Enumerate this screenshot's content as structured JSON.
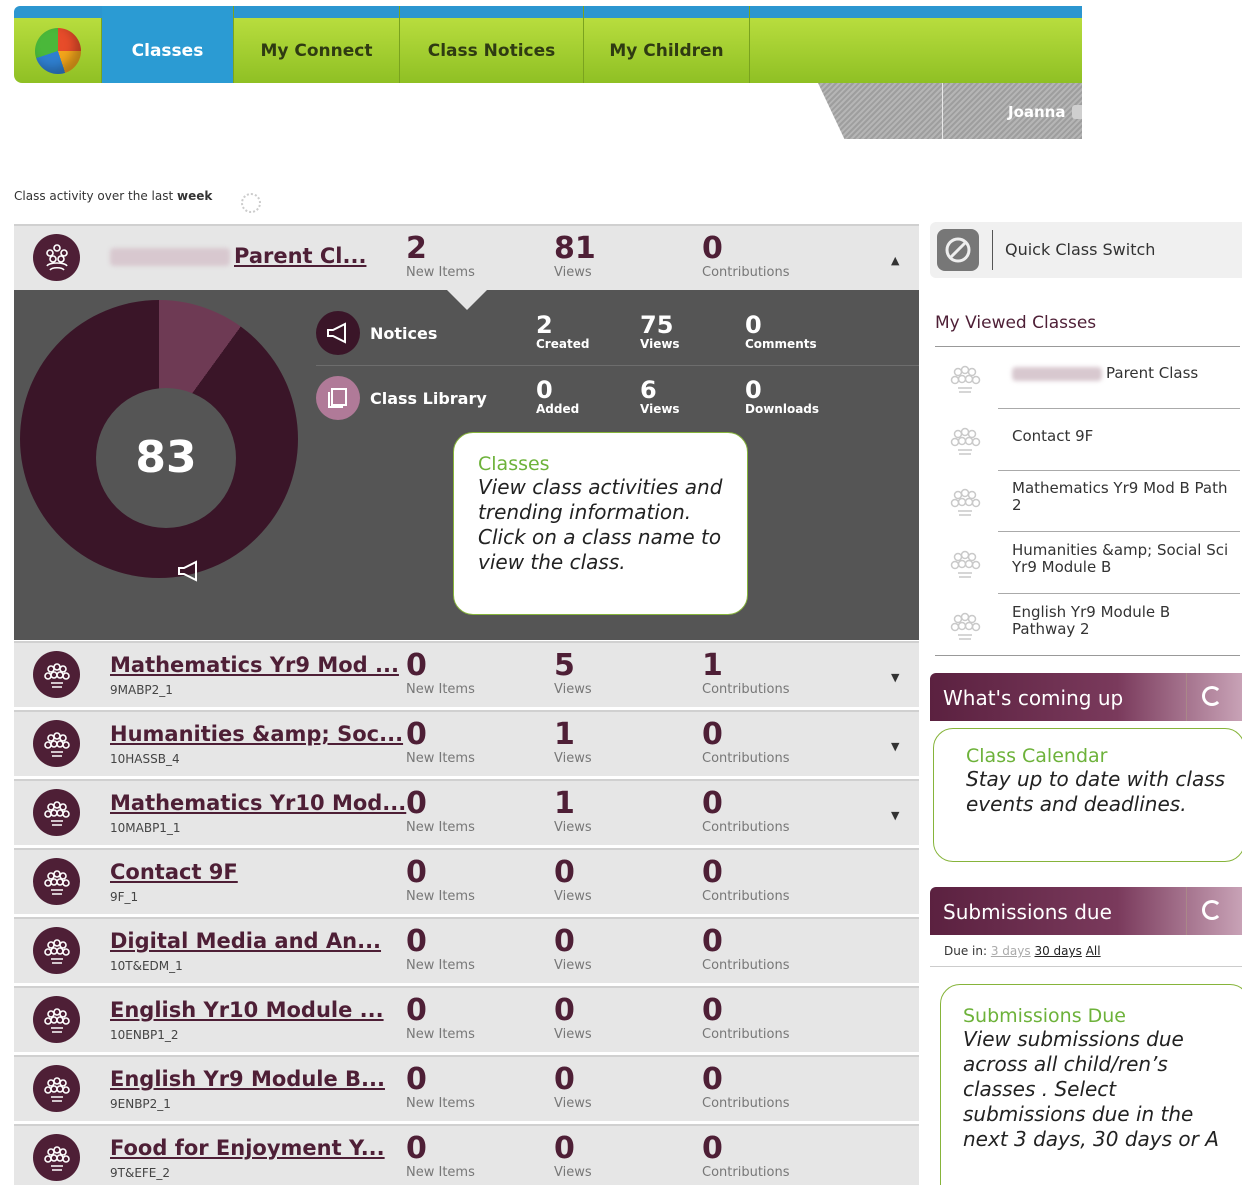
{
  "nav": {
    "tabs": [
      "Classes",
      "My Connect",
      "Class Notices",
      "My Children"
    ],
    "active_tab": "Classes",
    "user_name": "Joanna"
  },
  "activity": {
    "prefix": "Class activity over the last ",
    "period": "week"
  },
  "stat_labels": {
    "new_items": "New Items",
    "views": "Views",
    "contributions": "Contributions"
  },
  "first_class": {
    "title_suffix": "Parent Cl...",
    "new_items": "2",
    "views": "81",
    "contributions": "0"
  },
  "expanded": {
    "total": "83",
    "notices": {
      "label": "Notices",
      "created": "2",
      "created_label": "Created",
      "views": "75",
      "views_label": "Views",
      "comments": "0",
      "comments_label": "Comments"
    },
    "library": {
      "label": "Class Library",
      "added": "0",
      "added_label": "Added",
      "views": "6",
      "views_label": "Views",
      "downloads": "0",
      "downloads_label": "Downloads"
    }
  },
  "classes": [
    {
      "title": "Mathematics Yr9 Mod ...",
      "code": "9MABP2_1",
      "new_items": "0",
      "views": "5",
      "contributions": "1"
    },
    {
      "title": "Humanities &amp; Soc...",
      "code": "10HASSB_4",
      "new_items": "0",
      "views": "1",
      "contributions": "0"
    },
    {
      "title": "Mathematics Yr10 Mod...",
      "code": "10MABP1_1",
      "new_items": "0",
      "views": "1",
      "contributions": "0"
    },
    {
      "title": "Contact 9F",
      "code": "9F_1",
      "new_items": "0",
      "views": "0",
      "contributions": "0"
    },
    {
      "title": "Digital Media and An...",
      "code": "10T&EDM_1",
      "new_items": "0",
      "views": "0",
      "contributions": "0"
    },
    {
      "title": "English Yr10 Module ...",
      "code": "10ENBP1_2",
      "new_items": "0",
      "views": "0",
      "contributions": "0"
    },
    {
      "title": "English Yr9 Module B...",
      "code": "9ENBP2_1",
      "new_items": "0",
      "views": "0",
      "contributions": "0"
    },
    {
      "title": "Food for Enjoyment Y...",
      "code": "9T&EFE_2",
      "new_items": "0",
      "views": "0",
      "contributions": "0"
    }
  ],
  "callouts": {
    "classes": {
      "heading": "Classes",
      "body": "View class activities and trending information.  Click on a class name to view the class."
    },
    "calendar": {
      "heading": "Class Calendar",
      "body": "Stay up to date with class events and deadlines."
    },
    "submissions": {
      "heading": "Submissions Due",
      "body": "View submissions due across all  child/ren’s classes .  Select submissions due in the next 3 days, 30 days or A"
    }
  },
  "sidebar": {
    "quick_switch": "Quick Class Switch",
    "viewed_title": "My Viewed Classes",
    "viewed": [
      "Parent Class",
      "Contact 9F",
      "Mathematics Yr9 Mod B Path 2",
      "Humanities &amp; Social Sci Yr9 Module B",
      "English Yr9 Module B Pathway 2"
    ],
    "coming_up": "What's coming up",
    "submissions_due": "Submissions due",
    "due_in": "Due in:",
    "due_options": [
      "3 days",
      "30 days",
      "All"
    ]
  },
  "colors": {
    "brand_purple": "#4e1f36",
    "nav_green": "#a5cf33",
    "nav_blue": "#2b9bd3"
  }
}
